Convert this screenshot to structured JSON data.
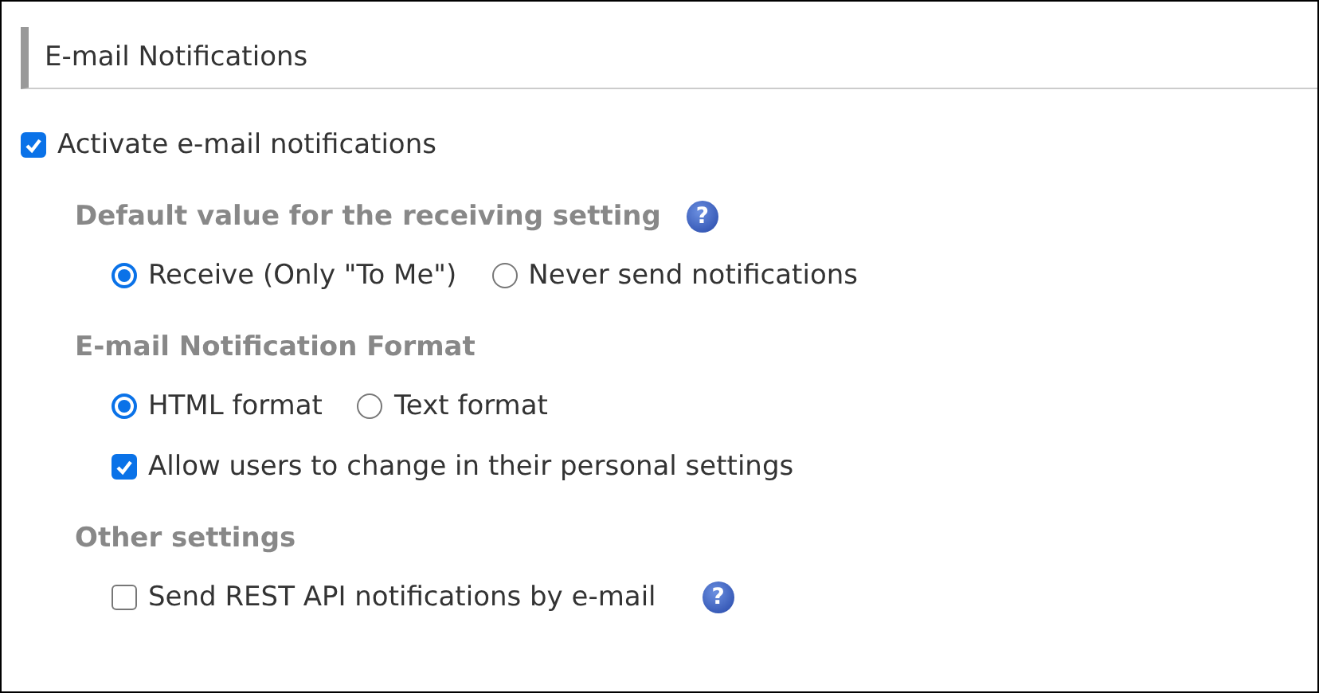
{
  "header": {
    "title": "E-mail Notifications"
  },
  "master": {
    "label": "Activate e-mail notifications",
    "checked": true
  },
  "sections": [
    {
      "heading": "Default value for the receiving setting",
      "help": "?",
      "rows": [
        {
          "kind": "radios",
          "options": [
            {
              "label": "Receive (Only \"To Me\")",
              "selected": true
            },
            {
              "label": "Never send notifications",
              "selected": false
            }
          ]
        }
      ]
    },
    {
      "heading": "E-mail Notification Format",
      "rows": [
        {
          "kind": "radios",
          "options": [
            {
              "label": "HTML format",
              "selected": true
            },
            {
              "label": "Text format",
              "selected": false
            }
          ]
        },
        {
          "kind": "checkbox",
          "label": "Allow users to change in their personal settings",
          "checked": true
        }
      ]
    },
    {
      "heading": "Other settings",
      "rows": [
        {
          "kind": "checkbox",
          "label": "Send REST API notifications by e-mail",
          "checked": false,
          "help": "?"
        }
      ]
    }
  ]
}
